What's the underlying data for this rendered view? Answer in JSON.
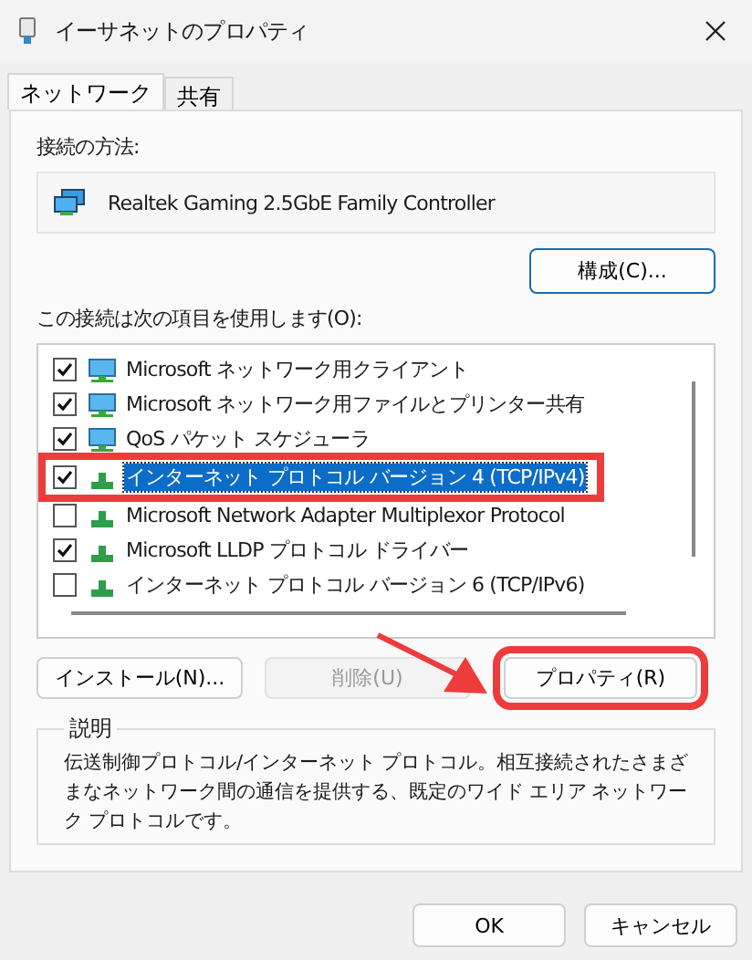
{
  "window": {
    "title": "イーサネットのプロパティ"
  },
  "tabs": [
    {
      "label": "ネットワーク",
      "selected": true
    },
    {
      "label": "共有",
      "selected": false
    }
  ],
  "connect_using": {
    "label": "接続の方法:",
    "adapter": "Realtek Gaming 2.5GbE Family Controller",
    "configure_button": "構成(C)..."
  },
  "items_label": "この接続は次の項目を使用します(O):",
  "items": [
    {
      "label": "Microsoft ネットワーク用クライアント",
      "kind": "client",
      "checked": true,
      "selected": false,
      "highlighted": false
    },
    {
      "label": "Microsoft ネットワーク用ファイルとプリンター共有",
      "kind": "client",
      "checked": true,
      "selected": false,
      "highlighted": false
    },
    {
      "label": "QoS パケット スケジューラ",
      "kind": "client",
      "checked": true,
      "selected": false,
      "highlighted": false
    },
    {
      "label": "インターネット プロトコル バージョン 4 (TCP/IPv4)",
      "kind": "protocol",
      "checked": true,
      "selected": true,
      "highlighted": true
    },
    {
      "label": "Microsoft Network Adapter Multiplexor Protocol",
      "kind": "protocol",
      "checked": false,
      "selected": false,
      "highlighted": false
    },
    {
      "label": "Microsoft LLDP プロトコル ドライバー",
      "kind": "protocol",
      "checked": true,
      "selected": false,
      "highlighted": false
    },
    {
      "label": "インターネット プロトコル バージョン 6 (TCP/IPv6)",
      "kind": "protocol",
      "checked": false,
      "selected": false,
      "highlighted": false
    }
  ],
  "item_buttons": [
    {
      "label": "インストール(N)...",
      "disabled": false,
      "highlighted": false
    },
    {
      "label": "削除(U)",
      "disabled": true,
      "highlighted": false
    },
    {
      "label": "プロパティ(R)",
      "disabled": false,
      "highlighted": true
    }
  ],
  "callout_arrow": true,
  "description": {
    "label": "説明",
    "text": "伝送制御プロトコル/インターネット プロトコル。相互接続されたさまざまなネットワーク間の通信を提供する、既定のワイド エリア ネットワーク プロトコルです。"
  },
  "buttons": [
    {
      "label": "OK"
    },
    {
      "label": "キャンセル"
    }
  ]
}
